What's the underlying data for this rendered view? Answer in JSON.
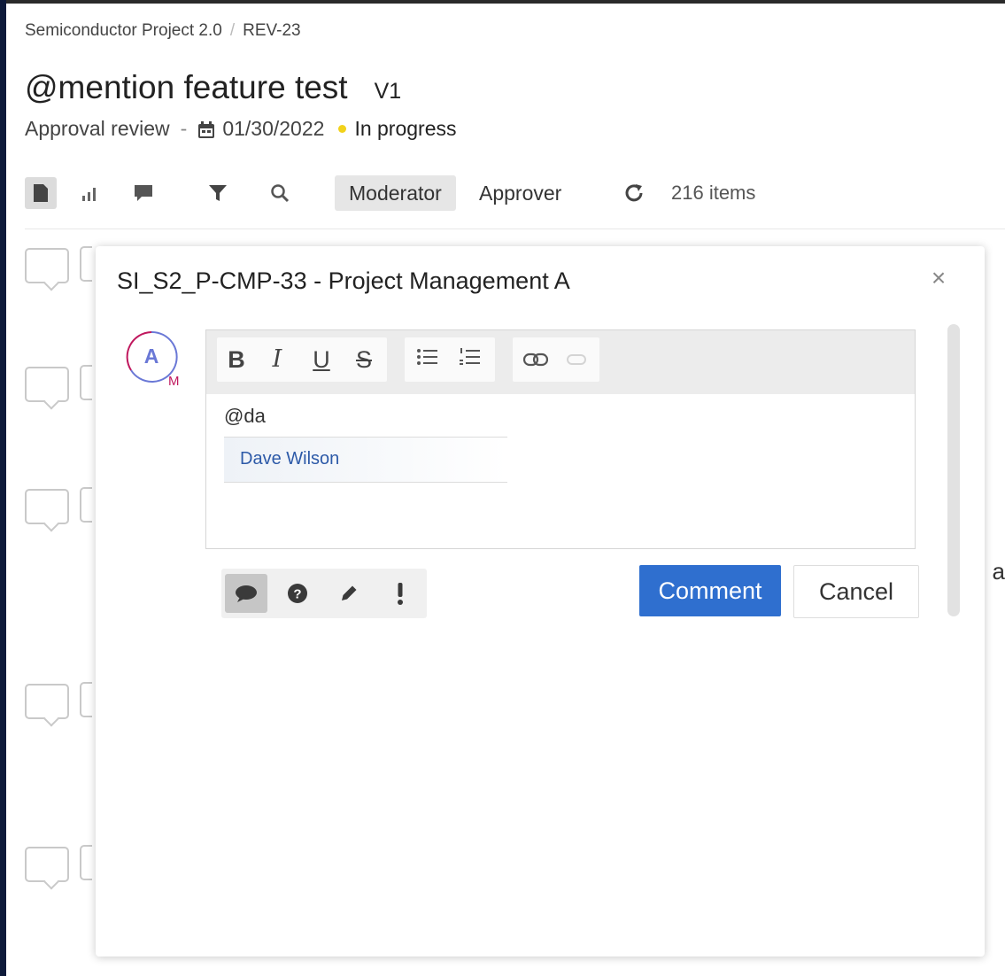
{
  "breadcrumb": {
    "project": "Semiconductor Project 2.0",
    "separator": "/",
    "revision": "REV-23"
  },
  "document": {
    "title": "@mention feature test",
    "version": "V1",
    "review_type": "Approval review",
    "dash": "-",
    "date": "01/30/2022",
    "status": "In progress",
    "status_color": "#f2d21b"
  },
  "toolbar": {
    "icons": [
      "document-icon",
      "chart-icon",
      "comment-icon",
      "filter-icon",
      "search-icon"
    ],
    "roles": [
      "Moderator",
      "Approver"
    ],
    "active_role": "Moderator",
    "refresh_icon": "refresh-icon",
    "items_count": "216 items"
  },
  "background": {
    "edge_text": "g a"
  },
  "modal": {
    "title": "SI_S2_P-CMP-33 - Project Management A",
    "close_label": "×",
    "avatar": {
      "letter": "A",
      "badge": "M"
    },
    "format_buttons": [
      {
        "name": "bold",
        "label": "B"
      },
      {
        "name": "italic",
        "label": "I"
      },
      {
        "name": "underline",
        "label": "U"
      },
      {
        "name": "strikethrough",
        "label": "S"
      }
    ],
    "list_icons": [
      "bulleted-list-icon",
      "numbered-list-icon"
    ],
    "link_icons": [
      "link-icon",
      "unlink-icon"
    ],
    "editor_text": "@da",
    "mention_suggestions": [
      "Dave Wilson"
    ],
    "comment_types": [
      "comment-type-icon",
      "question-icon",
      "edit-icon",
      "important-icon"
    ],
    "comment_button": "Comment",
    "cancel_button": "Cancel",
    "accent_color": "#2f6fcf"
  }
}
